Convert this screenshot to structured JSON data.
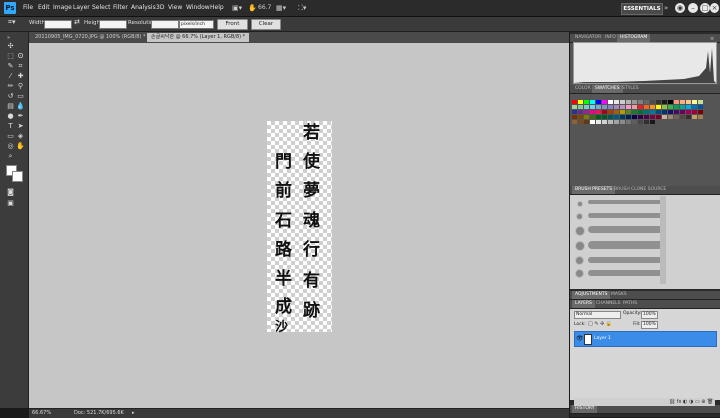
{
  "menubar": {
    "logo": "Ps",
    "menus": [
      "File",
      "Edit",
      "Image",
      "Layer",
      "Select",
      "Filter",
      "Analysis",
      "3D",
      "View",
      "Window",
      "Help"
    ],
    "zoom": "66.7",
    "workspace": "ESSENTIALS"
  },
  "options": {
    "width_label": "Width:",
    "height_label": "Height:",
    "resolution_label": "Resolution:",
    "resolution_unit": "pixels/inch",
    "front_image": "Front Image",
    "clear": "Clear"
  },
  "tabs": [
    {
      "label": "20110905_IMG_0720.JPG @ 100% (RGB/8) *",
      "active": false
    },
    {
      "label": "손글씨낙관 @ 66.7% (Layer 1, RGB/8) *",
      "active": true
    }
  ],
  "canvas": {
    "col_right": [
      "若",
      "使",
      "夢",
      "魂",
      "行",
      "有",
      "跡"
    ],
    "col_left": [
      "門",
      "前",
      "石",
      "路",
      "半",
      "成",
      "沙"
    ]
  },
  "status": {
    "zoom": "66.67%",
    "doc": "Doc: 521.7K/695.6K"
  },
  "panels": {
    "top_tabs": [
      "NAVIGATOR",
      "INFO",
      "HISTOGRAM"
    ],
    "color_tabs": [
      "COLOR",
      "SWATCHES",
      "STYLES"
    ],
    "brush_tabs": [
      "BRUSH PRESETS",
      "BRUSH",
      "CLONE SOURCE"
    ],
    "adjust_tabs": [
      "ADJUSTMENTS",
      "MASKS"
    ],
    "layer_tabs": [
      "LAYERS",
      "CHANNELS",
      "PATHS"
    ],
    "blend_mode": "Normal",
    "opacity_label": "Opacity:",
    "opacity": "100%",
    "lock_label": "Lock:",
    "fill_label": "Fill:",
    "fill": "100%",
    "layer_name": "Layer 1",
    "history_tab": "HISTORY"
  },
  "colors": {
    "accent": "#3b8be8",
    "canvas_bg": "#c6c6c6"
  }
}
